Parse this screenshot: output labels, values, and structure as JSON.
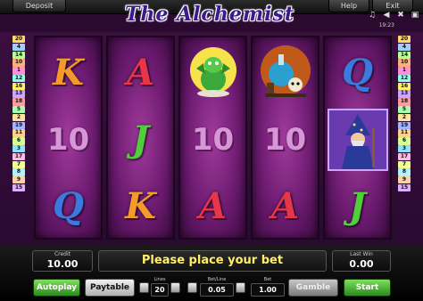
{
  "topbar": {
    "deposit_label": "Deposit",
    "help_label": "Help",
    "exit_label": "Exit",
    "clock": "19:23"
  },
  "logo": {
    "title": "The Alchemist"
  },
  "paylines": {
    "left": [
      "20",
      "4",
      "14",
      "10",
      "1",
      "12",
      "16",
      "13",
      "18",
      "5",
      "2",
      "19",
      "11",
      "6",
      "3",
      "17",
      "7",
      "8",
      "9",
      "15"
    ],
    "right": [
      "20",
      "4",
      "14",
      "10",
      "1",
      "12",
      "16",
      "13",
      "18",
      "5",
      "2",
      "19",
      "11",
      "6",
      "3",
      "17",
      "7",
      "8",
      "9",
      "15"
    ],
    "colors": [
      "#ffd86b",
      "#9bd0ff",
      "#b7ff8f",
      "#ffb07a",
      "#ff8fd8",
      "#8fffe6",
      "#ffef6b",
      "#c9a6ff",
      "#ff9b9b",
      "#a6ffb0",
      "#ffe39b",
      "#9bb8ff",
      "#ffcf8f",
      "#d6ff8f",
      "#8fe0ff",
      "#ffb8e6",
      "#f0ff8f",
      "#b0f0ff",
      "#ffd0a0",
      "#e0b0ff"
    ]
  },
  "reels": [
    [
      "K",
      "10",
      "Q"
    ],
    [
      "A",
      "J",
      "K"
    ],
    [
      "Dragon",
      "10",
      "A"
    ],
    [
      "Potion",
      "10",
      "A"
    ],
    [
      "Q",
      "Wizard",
      "J"
    ]
  ],
  "symbol_colors": {
    "K": "#f49a2a",
    "A": "#e8354a",
    "Q": "#3a7ae0",
    "J": "#4fcf3a"
  },
  "panels": {
    "credit_label": "Credit",
    "credit_value": "10.00",
    "message": "Please place your bet",
    "last_win_label": "Last Win",
    "last_win_value": "0.00"
  },
  "controls": {
    "autoplay_label": "Autoplay",
    "paytable_label": "Paytable",
    "lines_label": "Lines",
    "lines_value": "20",
    "bet_line_label": "Bet/Line",
    "bet_line_value": "0.05",
    "bet_label": "Bet",
    "bet_value": "1.00",
    "gamble_label": "Gamble",
    "start_label": "Start"
  }
}
